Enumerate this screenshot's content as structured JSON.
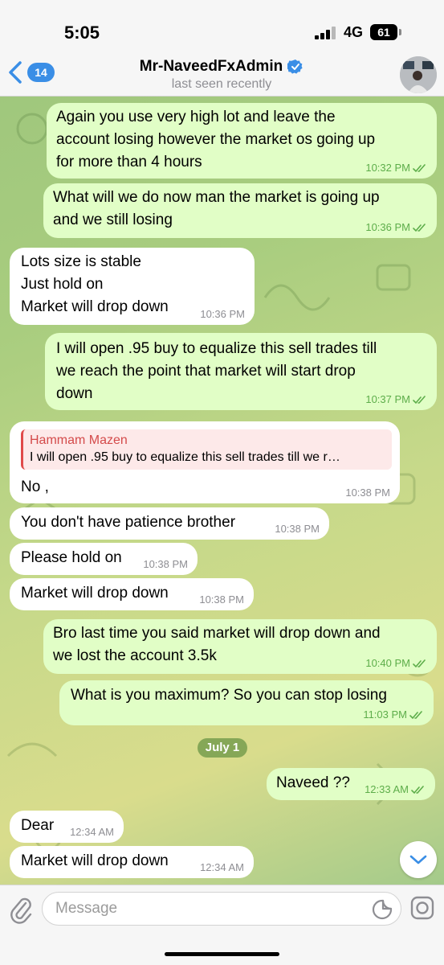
{
  "status_bar": {
    "time": "5:05",
    "network": "4G",
    "battery": "61"
  },
  "header": {
    "back_count": "14",
    "contact_name": "Mr-NaveedFxAdmin",
    "contact_status": "last seen recently"
  },
  "messages": [
    {
      "dir": "out",
      "text": "Again you use very high lot and leave the\naccount losing however the market os going up\nfor more than 4 hours",
      "time": "10:32 PM",
      "read": true
    },
    {
      "dir": "out",
      "text": "What will we do now man the market is going up\nand we still losing",
      "time": "10:36 PM",
      "read": true
    },
    {
      "dir": "in",
      "text": "Lots size is stable\nJust hold on\nMarket will drop down",
      "time": "10:36 PM"
    },
    {
      "dir": "out",
      "text": "I will open .95 buy to equalize this sell trades till\nwe reach the point that market will start drop\ndown",
      "time": "10:37 PM",
      "read": true
    },
    {
      "dir": "in",
      "reply_author": "Hammam Mazen",
      "reply_text": "I will open .95 buy to equalize this sell trades till we r…",
      "text": "No ,",
      "time": "10:38 PM"
    },
    {
      "dir": "in",
      "text": "You don't have patience brother",
      "time": "10:38 PM"
    },
    {
      "dir": "in",
      "text": "Please hold on",
      "time": "10:38 PM"
    },
    {
      "dir": "in",
      "text": "Market will drop down",
      "time": "10:38 PM"
    },
    {
      "dir": "out",
      "text": "Bro last time you said market will drop down and\nwe lost the account 3.5k",
      "time": "10:40 PM",
      "read": true
    },
    {
      "dir": "out",
      "text": "What is you maximum? So you can stop losing",
      "time": "11:03 PM",
      "read": true
    },
    {
      "dir": "out",
      "text": "Naveed ??",
      "time": "12:33 AM",
      "read": true
    },
    {
      "dir": "in",
      "text": "Dear",
      "time": "12:34 AM"
    },
    {
      "dir": "in",
      "text": "Market will drop down",
      "time": "12:34 AM"
    }
  ],
  "date_separator": "July 1",
  "composer": {
    "placeholder": "Message"
  },
  "colors": {
    "outgoing_bubble": "#e1fec6",
    "incoming_bubble": "#ffffff",
    "accent": "#3a8ee6",
    "read_ticks": "#5dad4a"
  },
  "icons": [
    "back-chevron-icon",
    "verified-badge-icon",
    "attach-icon",
    "sticker-icon",
    "camera-icon",
    "scroll-down-icon"
  ]
}
